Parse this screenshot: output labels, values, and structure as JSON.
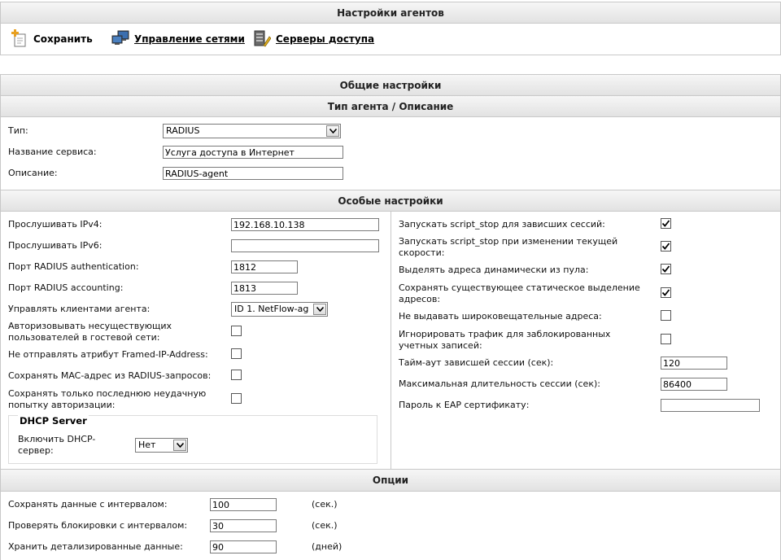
{
  "agent_settings": {
    "title": "Настройки агентов",
    "toolbar": {
      "save": "Сохранить",
      "network_mgmt": "Управление сетями",
      "access_servers": "Серверы доступа"
    }
  },
  "general": {
    "title": "Общие настройки",
    "type_section": "Тип агента / Описание",
    "type_label": "Тип:",
    "type_value": "RADIUS",
    "service_label": "Название сервиса:",
    "service_value": "Услуга доступа в Интернет",
    "description_label": "Описание:",
    "description_value": "RADIUS-agent"
  },
  "special": {
    "title": "Особые настройки",
    "left": {
      "ipv4_label": "Прослушивать IPv4:",
      "ipv4_value": "192.168.10.138",
      "ipv6_label": "Прослушивать IPv6:",
      "ipv6_value": "",
      "auth_port_label": "Порт RADIUS authentication:",
      "auth_port_value": "1812",
      "acct_port_label": "Порт RADIUS accounting:",
      "acct_port_value": "1813",
      "manage_clients_label": "Управлять клиентами агента:",
      "manage_clients_value": "ID 1. NetFlow-ag",
      "guest_auth_label": "Авторизовывать несуществующих пользователей в гостевой сети:",
      "guest_auth_checked": false,
      "no_framed_ip_label": "Не отправлять атрибут Framed-IP-Address:",
      "no_framed_ip_checked": false,
      "save_mac_label": "Сохранять MAC-адрес из RADIUS-запросов:",
      "save_mac_checked": false,
      "last_failed_label": "Сохранять только последнюю неудачную попытку авторизации:",
      "last_failed_checked": false,
      "dhcp": {
        "legend": "DHCP Server",
        "enable_label": "Включить DHCP-сервер:",
        "enable_value": "Нет"
      }
    },
    "right": {
      "script_stop_hung_label": "Запускать script_stop для зависших сессий:",
      "script_stop_hung_checked": true,
      "script_stop_speed_label": "Запускать script_stop при изменении текущей скорости:",
      "script_stop_speed_checked": true,
      "dynamic_pool_label": "Выделять адреса динамически из пула:",
      "dynamic_pool_checked": true,
      "keep_static_label": "Сохранять существующее статическое выделение адресов:",
      "keep_static_checked": true,
      "no_broadcast_label": "Не выдавать широковещательные адреса:",
      "no_broadcast_checked": false,
      "ignore_blocked_label": "Игнорировать трафик для заблокированных учетных записей:",
      "ignore_blocked_checked": false,
      "hung_timeout_label": "Тайм-аут зависшей сессии (сек):",
      "hung_timeout_value": "120",
      "max_session_label": "Максимальная длительность сессии (сек):",
      "max_session_value": "86400",
      "eap_password_label": "Пароль к EAP сертификату:",
      "eap_password_value": ""
    }
  },
  "options": {
    "title": "Опции",
    "save_interval_label": "Сохранять данные с интервалом:",
    "save_interval_value": "100",
    "save_interval_unit": "(сек.)",
    "check_block_label": "Проверять блокировки с интервалом:",
    "check_block_value": "30",
    "check_block_unit": "(сек.)",
    "keep_detail_label": "Хранить детализированные данные:",
    "keep_detail_value": "90",
    "keep_detail_unit": "(дней)"
  }
}
